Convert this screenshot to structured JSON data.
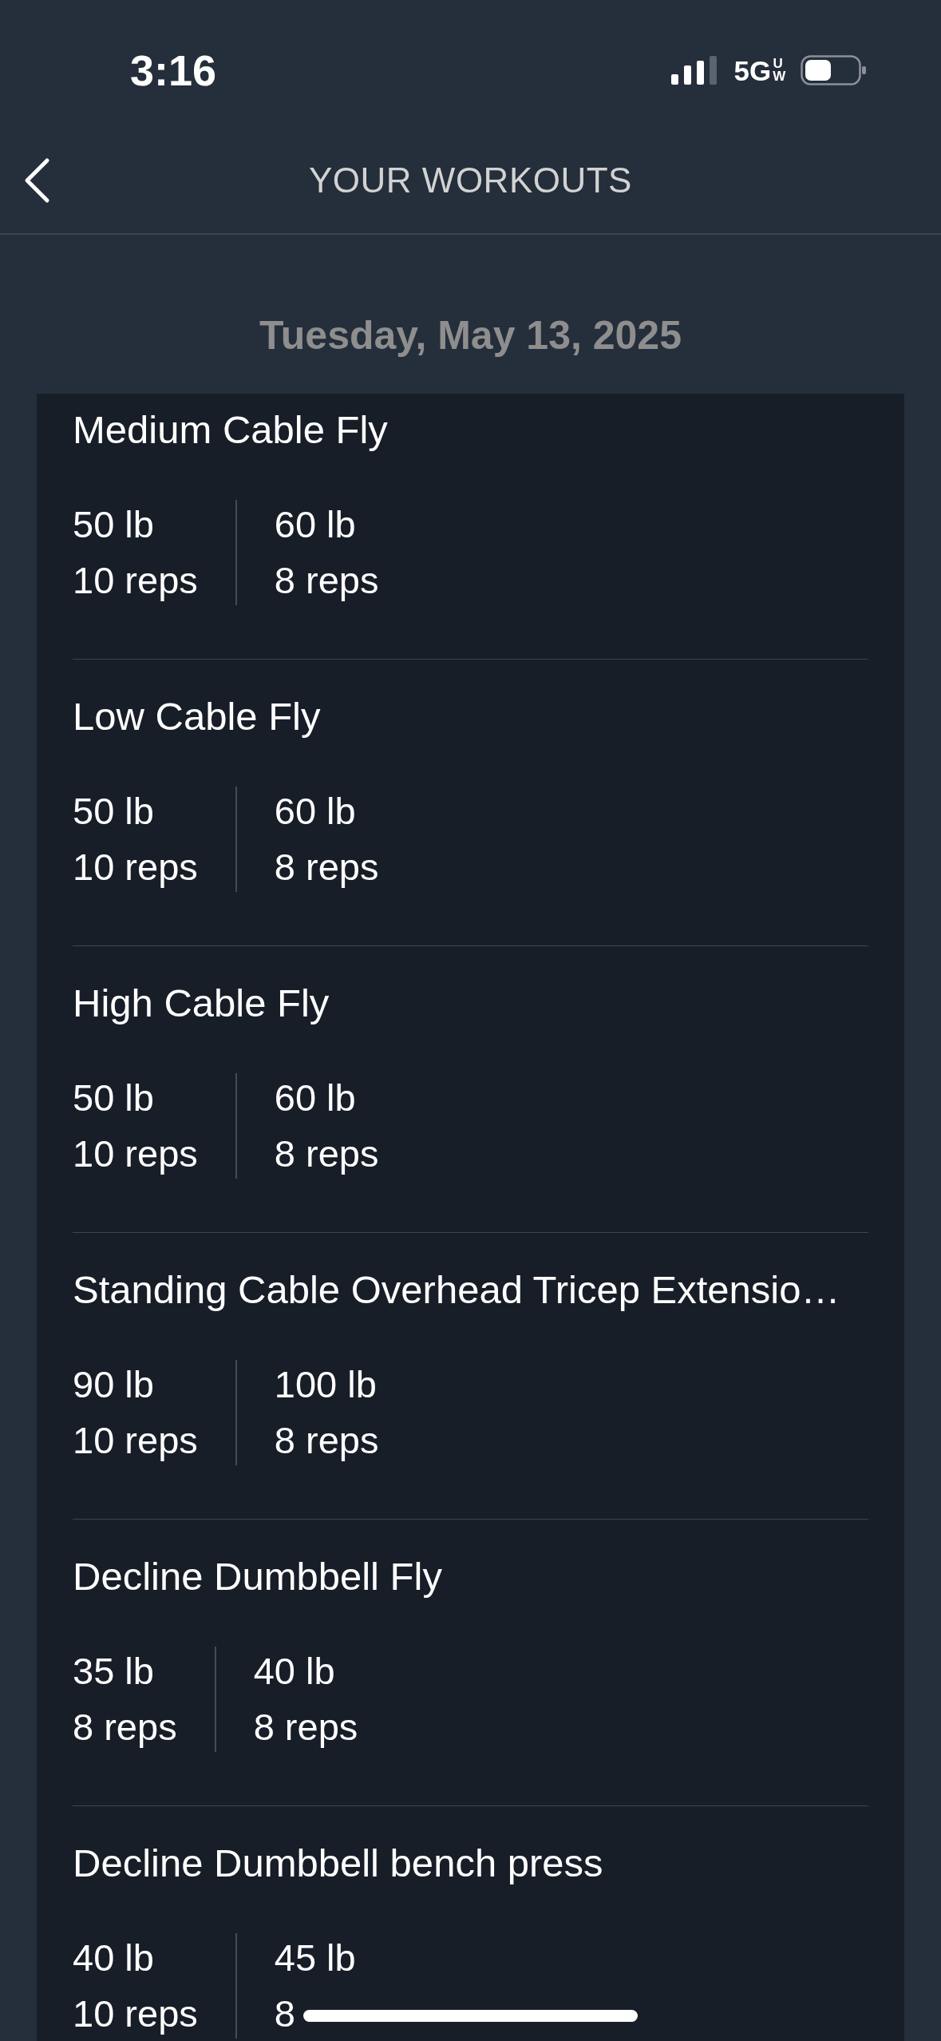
{
  "status_bar": {
    "time": "3:16",
    "network": "5G",
    "network_badge": "UW"
  },
  "header": {
    "title": "YOUR WORKOUTS"
  },
  "date": "Tuesday, May 13, 2025",
  "exercises": [
    {
      "name": "Medium Cable Fly",
      "sets": [
        {
          "weight": "50 lb",
          "reps": "10 reps"
        },
        {
          "weight": "60 lb",
          "reps": "8 reps"
        }
      ]
    },
    {
      "name": "Low Cable Fly",
      "sets": [
        {
          "weight": "50 lb",
          "reps": "10 reps"
        },
        {
          "weight": "60 lb",
          "reps": "8 reps"
        }
      ]
    },
    {
      "name": "High Cable Fly",
      "sets": [
        {
          "weight": "50 lb",
          "reps": "10 reps"
        },
        {
          "weight": "60 lb",
          "reps": "8 reps"
        }
      ]
    },
    {
      "name": "Standing Cable Overhead Tricep Extensio…",
      "sets": [
        {
          "weight": "90 lb",
          "reps": "10 reps"
        },
        {
          "weight": "100 lb",
          "reps": "8 reps"
        }
      ]
    },
    {
      "name": "Decline Dumbbell Fly",
      "sets": [
        {
          "weight": "35 lb",
          "reps": "8 reps"
        },
        {
          "weight": "40 lb",
          "reps": "8 reps"
        }
      ]
    },
    {
      "name": "Decline Dumbbell bench press",
      "sets": [
        {
          "weight": "40 lb",
          "reps": "10 reps"
        },
        {
          "weight": "45 lb",
          "reps": "8"
        }
      ]
    }
  ]
}
